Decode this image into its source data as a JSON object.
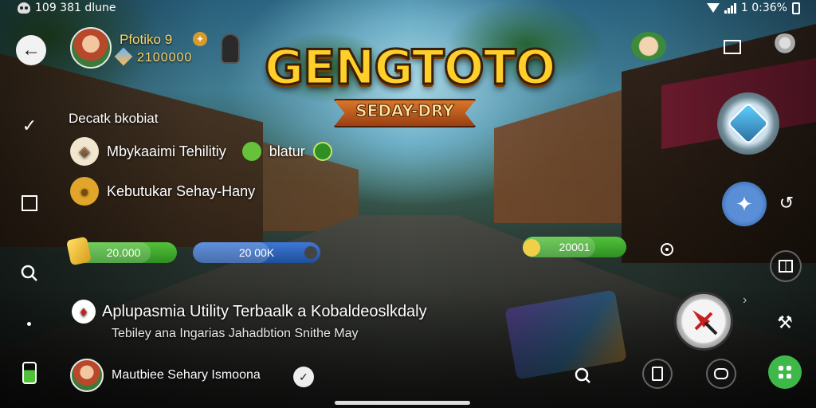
{
  "status_bar": {
    "left_text": "109 381 dlune",
    "right_text": "1 0:36%"
  },
  "logo": {
    "title": "GENGTOTO",
    "subtitle": "SEDAY-DRY"
  },
  "player": {
    "name": "Pfotiko 9",
    "score": "2100000"
  },
  "menu": {
    "heading": "Decatk bkobiat",
    "row1_label": "Mbykaaimi Tehilitiy",
    "row1_extra": "blatur",
    "row2_label": "Kebutukar Sehay-Hany"
  },
  "resources": [
    {
      "label": "20.000",
      "color": "#3aa52b",
      "level": 0.75
    },
    {
      "label": "20 00K",
      "color": "#2b63c0",
      "level": 0.6
    },
    {
      "label": "20001",
      "color": "#3aa52b",
      "level": 0.7
    }
  ],
  "utility": {
    "title": "Aplupasmia Utility Terbaalk a Kobaldeoslkdaly",
    "subtitle": "Tebiley ana Ingarias  Jahadbtion Snithe May"
  },
  "bottom_player": {
    "name": "Mautbiee Sehary Ismoona"
  },
  "icons": {
    "back": "arrow-left-icon",
    "attack": "sword-icon",
    "shield": "shield-icon",
    "skill": "skill-icon",
    "menu": "grid-icon"
  },
  "colors": {
    "accent_green": "#3aa52b",
    "accent_blue": "#2b63c0",
    "logo_gold": "#ffcf2a"
  }
}
